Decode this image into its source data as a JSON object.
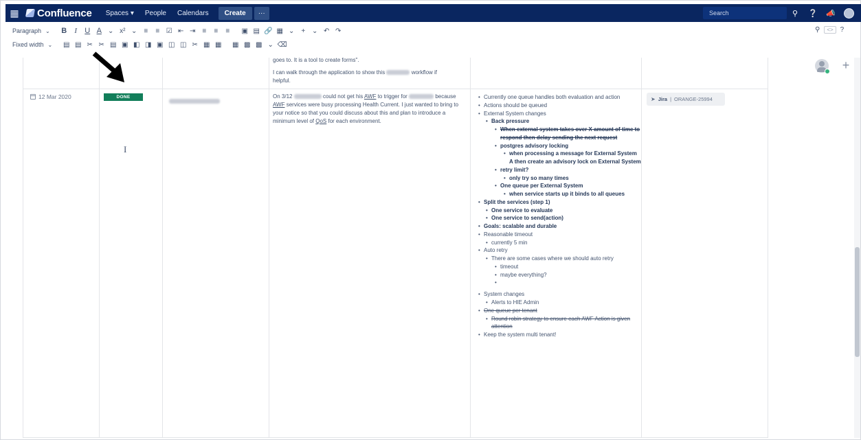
{
  "topnav": {
    "logo": "Confluence",
    "items": [
      "Spaces ▾",
      "People",
      "Calendars"
    ],
    "create": "Create",
    "more": "···",
    "search_placeholder": "Search"
  },
  "toolbar": {
    "style_label": "Paragraph",
    "width_label": "Fixed width",
    "bold": "B",
    "italic": "I",
    "underline": "U",
    "text_color": "A",
    "more_format": "x²"
  },
  "row_prev": {
    "line1": "goes to.  It is a tool to create forms\".",
    "line2a": "I can walk through the application to show this",
    "line2b": "workflow if",
    "line3": "helpful."
  },
  "row": {
    "date": "12 Mar 2020",
    "status": "DONE",
    "desc": {
      "p1": "On 3/12",
      "p2": "could not get his",
      "awf": "AWF",
      "p3": "to trigger for",
      "p4": "because",
      "p5": "services were busy processing Health Current. I just wanted to bring to your notice so that you could discuss about this and plan to introduce a minimum level of",
      "qos": "QoS",
      "p6": "for each environment."
    },
    "notes": [
      "Currently one queue handles both evaluation and action",
      "Actions should be queued",
      "External System changes",
      "Back pressure",
      "When external system takes over X amount of time to respond then delay sending the next request",
      "postgres advisory locking",
      "when processing a message for External System A then create an advisory lock on External System",
      "retry limit?",
      "only try so many times",
      "One queue per External System",
      "when service starts up it binds to all queues",
      "Split the services (step 1)",
      "One service to evaluate",
      "One service to send(action)",
      "Goals: scalable and durable",
      "Reasonable timeout",
      "currently 5 min",
      "Auto retry",
      "There are some cases where we should auto retry",
      "timeout",
      "maybe everything?",
      "",
      "System changes",
      "Alerts to HIE Admin",
      "One queue per tenant",
      "Round robin strategy to ensure each AWF Action is given attention",
      "Keep the system multi tenant!"
    ],
    "jira": {
      "name": "Jira",
      "key": "ORANGE-25994"
    }
  },
  "colors": {
    "nav_bg": "#0a2660",
    "status_done": "#127e5a",
    "online": "#36b37e"
  }
}
